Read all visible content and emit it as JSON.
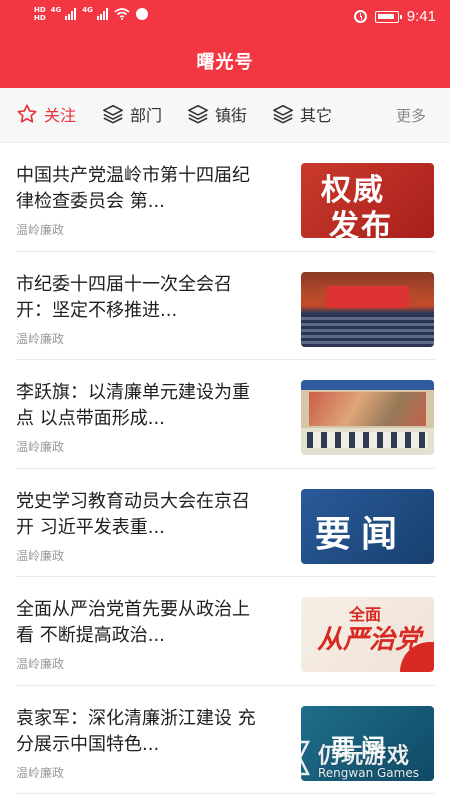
{
  "status_bar": {
    "hd_top": "HD",
    "hd_bottom": "HD",
    "net1": "4G",
    "net2": "4G",
    "time": "9:41"
  },
  "header": {
    "title": "曙光号"
  },
  "tabs": [
    {
      "label": "关注",
      "icon": "star-icon",
      "active": true
    },
    {
      "label": "部门",
      "icon": "layers-icon",
      "active": false
    },
    {
      "label": "镇街",
      "icon": "layers-icon",
      "active": false
    },
    {
      "label": "其它",
      "icon": "layers-icon",
      "active": false
    }
  ],
  "more_label": "更多",
  "articles": [
    {
      "title": "中国共产党温岭市第十四届纪律检查委员会 第...",
      "source": "温岭廉政",
      "thumb": {
        "line1": "权威",
        "line2": "发布"
      }
    },
    {
      "title": "市纪委十四届十一次全会召开：坚定不移推进...",
      "source": "温岭廉政"
    },
    {
      "title": "李跃旗：以清廉单元建设为重点 以点带面形成...",
      "source": "温岭廉政"
    },
    {
      "title": "党史学习教育动员大会在京召开 习近平发表重...",
      "source": "温岭廉政",
      "thumb": {
        "text": "要闻"
      }
    },
    {
      "title": "全面从严治党首先要从政治上看 不断提高政治...",
      "source": "温岭廉政",
      "thumb": {
        "line1": "全面",
        "line2": "从严治党"
      }
    },
    {
      "title": "袁家军：深化清廉浙江建设 充分展示中国特色...",
      "source": "温岭廉政",
      "thumb": {
        "text": "要闻"
      }
    }
  ],
  "watermark": {
    "cn": "仍玩游戏",
    "en": "Rengwan Games"
  },
  "colors": {
    "brand_red": "#f33742",
    "active_tab": "#e8323c"
  }
}
